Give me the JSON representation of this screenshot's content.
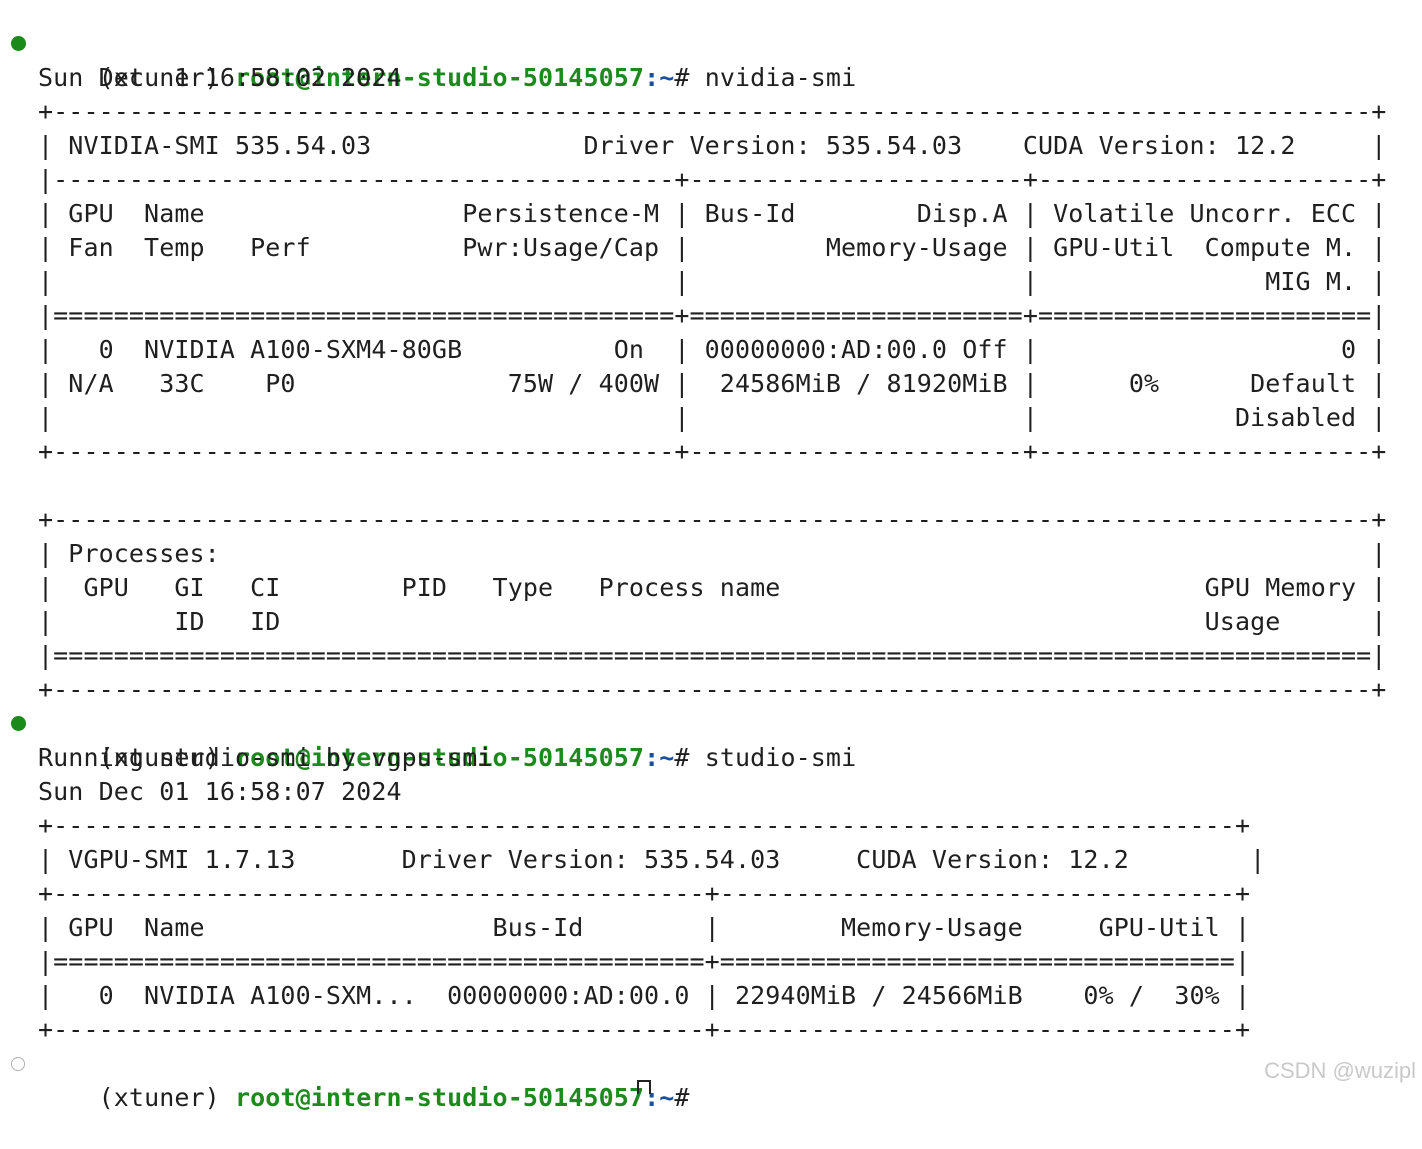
{
  "prompt": {
    "venv": "(xtuner)",
    "user_host": "root@intern-studio-50145057",
    "path": ":~",
    "symbol": "#"
  },
  "commands": {
    "first": "nvidia-smi",
    "second": "studio-smi"
  },
  "output": {
    "date1": "Sun Dec  1 16:58:02 2024",
    "nvidia_smi_lines": [
      "+---------------------------------------------------------------------------------------+",
      "| NVIDIA-SMI 535.54.03              Driver Version: 535.54.03    CUDA Version: 12.2     |",
      "|-----------------------------------------+----------------------+----------------------+",
      "| GPU  Name                 Persistence-M | Bus-Id        Disp.A | Volatile Uncorr. ECC |",
      "| Fan  Temp   Perf          Pwr:Usage/Cap |         Memory-Usage | GPU-Util  Compute M. |",
      "|                                         |                      |               MIG M. |",
      "|=========================================+======================+======================|",
      "|   0  NVIDIA A100-SXM4-80GB          On  | 00000000:AD:00.0 Off |                    0 |",
      "| N/A   33C    P0              75W / 400W |  24586MiB / 81920MiB |      0%      Default |",
      "|                                         |                      |             Disabled |",
      "+-----------------------------------------+----------------------+----------------------+",
      "",
      "+---------------------------------------------------------------------------------------+",
      "| Processes:                                                                            |",
      "|  GPU   GI   CI        PID   Type   Process name                            GPU Memory |",
      "|        ID   ID                                                             Usage      |",
      "|=======================================================================================|",
      "+---------------------------------------------------------------------------------------+"
    ],
    "running_line": "Running studio-smi by vgpu-smi",
    "date2": "Sun Dec 01 16:58:07 2024",
    "vgpu_lines": [
      "+------------------------------------------------------------------------------+",
      "| VGPU-SMI 1.7.13       Driver Version: 535.54.03     CUDA Version: 12.2        |",
      "+-------------------------------------------+----------------------------------+",
      "| GPU  Name                   Bus-Id        |        Memory-Usage     GPU-Util |",
      "|===========================================+==================================|",
      "|   0  NVIDIA A100-SXM...  00000000:AD:00.0 | 22940MiB / 24566MiB    0% /  30% |",
      "+-------------------------------------------+----------------------------------+"
    ]
  },
  "watermark": "CSDN @wuzipl",
  "colors": {
    "prompt_user": "#1d8a1d",
    "prompt_path": "#1a4f9c",
    "status_dot_success": "#1a8a1a",
    "text": "#1f1f1f"
  }
}
